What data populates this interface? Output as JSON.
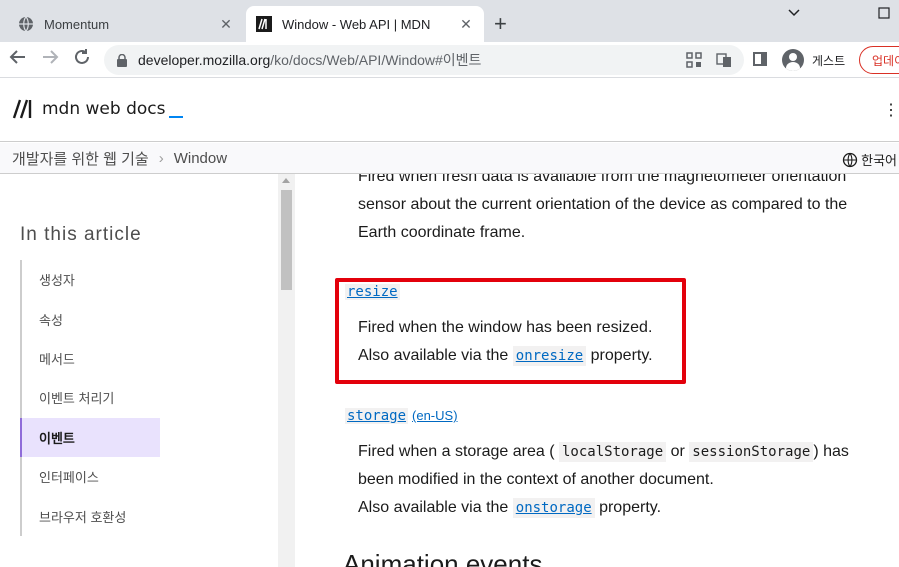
{
  "browser": {
    "tabs": [
      {
        "title": "Momentum",
        "icon": "globe-icon",
        "active": false
      },
      {
        "title": "Window - Web API | MDN",
        "icon": "mdn-icon",
        "active": true
      }
    ],
    "url_host": "developer.mozilla.org",
    "url_path": "/ko/docs/Web/API/Window#이벤트",
    "profile_label": "게스트",
    "update_label": "업데이"
  },
  "mdn": {
    "logo_text": "mdn web docs",
    "breadcrumbs": [
      "개발자를 위한 웹 기술",
      "Window"
    ],
    "language": "한국어"
  },
  "sidebar": {
    "title": "In this article",
    "items": [
      {
        "label": "생성자",
        "active": false
      },
      {
        "label": "속성",
        "active": false
      },
      {
        "label": "메서드",
        "active": false
      },
      {
        "label": "이벤트 처리기",
        "active": false
      },
      {
        "label": "이벤트",
        "active": true
      },
      {
        "label": "인터페이스",
        "active": false
      },
      {
        "label": "브라우저 호환성",
        "active": false
      }
    ]
  },
  "content": {
    "prev_desc_line1": "Fired when fresh data is available from the magnetometer orientation",
    "prev_desc_line2": "sensor about the current orientation of the device as compared to the",
    "prev_desc_line3": "Earth coordinate frame.",
    "resize": {
      "term": "resize",
      "desc": "Fired when the window has been resized.",
      "also_pre": "Also available via the",
      "also_link": "onresize",
      "also_post": "property."
    },
    "storage": {
      "term": "storage",
      "badge": "(en-US)",
      "desc_pre": "Fired when a storage area (",
      "code1": "localStorage",
      "desc_mid": "or",
      "code2": "sessionStorage",
      "desc_post": ") has",
      "desc_line2": "been modified in the context of another document.",
      "also_pre": "Also available via the",
      "also_link": "onstorage",
      "also_post": "property."
    },
    "next_heading": "Animation events"
  },
  "colors": {
    "highlight": "#e3000b",
    "link": "#0069c2",
    "active_toc_bg": "#e9e2fd",
    "active_toc_border": "#8f6cd9"
  }
}
